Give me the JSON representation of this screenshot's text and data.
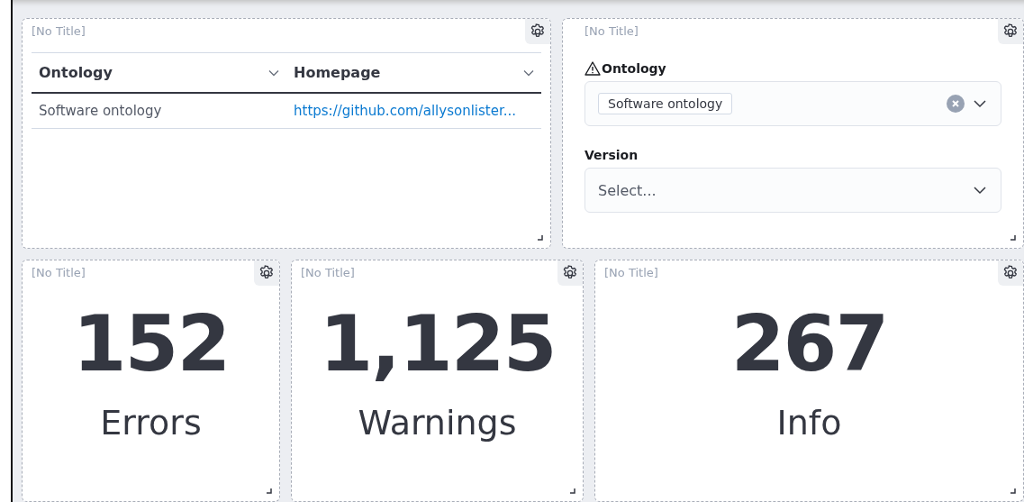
{
  "table_panel": {
    "title": "[No Title]",
    "columns": [
      {
        "label": "Ontology"
      },
      {
        "label": "Homepage"
      }
    ],
    "rows": [
      {
        "ontology": "Software ontology",
        "homepage": "https://github.com/allysonlister..."
      }
    ]
  },
  "filter_panel": {
    "title": "[No Title]",
    "fields": [
      {
        "label": "Ontology",
        "warning": true,
        "tags": [
          "Software ontology"
        ],
        "clearable": true
      },
      {
        "label": "Version",
        "warning": false,
        "placeholder": "Select...",
        "clearable": false
      }
    ]
  },
  "stat_panels": [
    {
      "title": "[No Title]",
      "value": "152",
      "label": "Errors"
    },
    {
      "title": "[No Title]",
      "value": "1,125",
      "label": "Warnings"
    },
    {
      "title": "[No Title]",
      "value": "267",
      "label": "Info"
    }
  ]
}
